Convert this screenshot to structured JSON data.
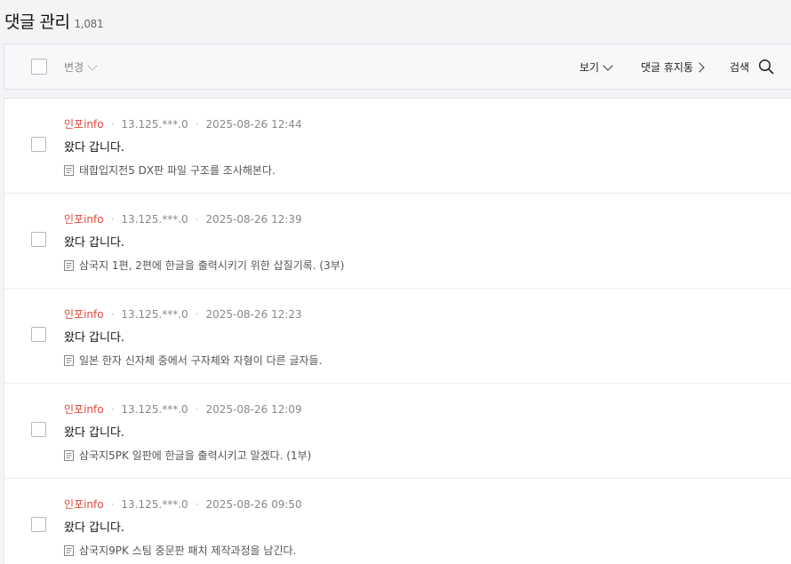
{
  "header": {
    "title": "댓글 관리",
    "count": "1,081"
  },
  "toolbar": {
    "change_label": "변경",
    "view_label": "보기",
    "trash_label": "댓글 휴지통",
    "search_label": "검색"
  },
  "comments": [
    {
      "author": "인포info",
      "ip": "13.125.***.0",
      "datetime": "2025-08-26 12:44",
      "content": "왔다 갑니다.",
      "post_title": "태합입지전5 DX판 파일 구조를 조사해본다."
    },
    {
      "author": "인포info",
      "ip": "13.125.***.0",
      "datetime": "2025-08-26 12:39",
      "content": "왔다 갑니다.",
      "post_title": "삼국지 1편, 2편에 한글을 출력시키기 위한 삽질기록. (3부)"
    },
    {
      "author": "인포info",
      "ip": "13.125.***.0",
      "datetime": "2025-08-26 12:23",
      "content": "왔다 갑니다.",
      "post_title": "일본 한자 신자체 중에서 구자체와 자형이 다른 글자들."
    },
    {
      "author": "인포info",
      "ip": "13.125.***.0",
      "datetime": "2025-08-26 12:09",
      "content": "왔다 갑니다.",
      "post_title": "삼국지5PK 일판에 한글을 출력시키고 말겠다. (1부)"
    },
    {
      "author": "인포info",
      "ip": "13.125.***.0",
      "datetime": "2025-08-26 09:50",
      "content": "왔다 갑니다.",
      "post_title": "삼국지9PK 스팀 중문판 패치 제작과정을 남긴다."
    }
  ],
  "icons": {
    "search": "search-icon",
    "document": "document-icon",
    "chevron_down": "chevron-down-icon",
    "chevron_right": "chevron-right-icon"
  },
  "colors": {
    "author": "#e2473a",
    "background": "#f3f4f6"
  }
}
